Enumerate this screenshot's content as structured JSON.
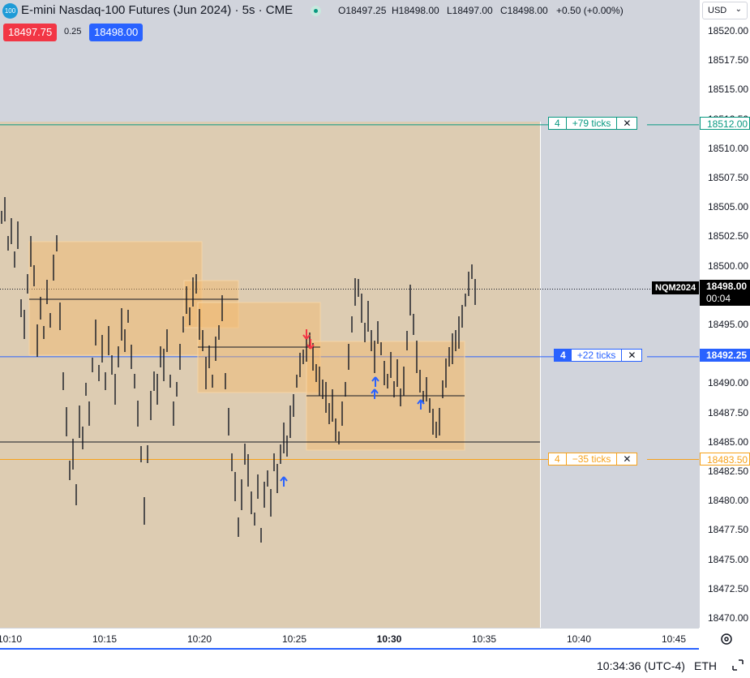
{
  "header": {
    "symbol_badge": "100",
    "title": "E-mini Nasdaq-100 Futures (Jun 2024) · 5s · CME",
    "ohlc": {
      "open": "O18497.25",
      "high": "H18498.00",
      "low": "L18497.00",
      "close": "C18498.00",
      "change": "+0.50 (+0.00%)"
    },
    "sell_price": "18497.75",
    "spread": "0.25",
    "buy_price": "18498.00"
  },
  "currency": "USD",
  "price_axis": [
    "18520.00",
    "18517.50",
    "18515.00",
    "18512.50",
    "18510.00",
    "18507.50",
    "18505.00",
    "18502.50",
    "18500.00",
    "18495.00",
    "18490.00",
    "18487.50",
    "18485.00",
    "18482.50",
    "18480.00",
    "18477.50",
    "18475.00",
    "18472.50",
    "18470.00"
  ],
  "time_axis": [
    "10:10",
    "10:15",
    "10:20",
    "10:25",
    "10:30",
    "10:35",
    "10:40",
    "10:45"
  ],
  "orders": {
    "take_profit": {
      "qty": "4",
      "label": "+79 ticks",
      "price": "18512.00",
      "color": "#089981"
    },
    "position": {
      "qty": "4",
      "label": "+22 ticks",
      "price": "18492.25",
      "color": "#2962ff"
    },
    "stop_loss": {
      "qty": "4",
      "label": "−35 ticks",
      "price": "18483.50",
      "color": "#f7a21b"
    }
  },
  "last_price": {
    "symbol": "NQM2024",
    "price": "18498.00",
    "countdown": "00:04"
  },
  "status_bar": {
    "time": "10:34:36 (UTC-4)",
    "session": "ETH"
  }
}
